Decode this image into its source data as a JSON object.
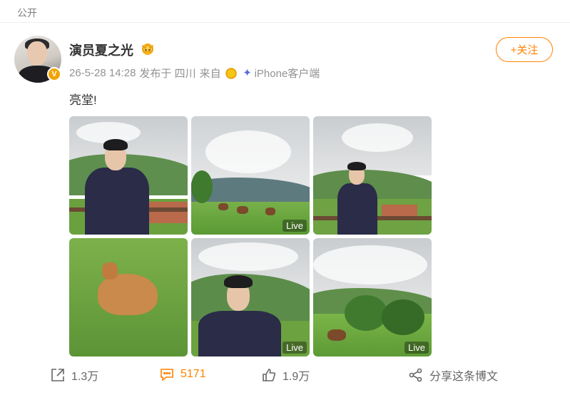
{
  "header": {
    "visibility": "公开"
  },
  "post": {
    "username": "演员夏之光",
    "crown_icon": "crown-icon",
    "verified_icon": "verified-v-icon",
    "follow_label": "+关注",
    "datetime": "26-5-28 14:28",
    "published_in": "发布于 四川",
    "source_prefix": "来自",
    "source": "iPhone客户端",
    "text": "亮堂!",
    "photos": [
      {
        "live": ""
      },
      {
        "live": "Live"
      },
      {
        "live": ""
      },
      {
        "live": ""
      },
      {
        "live": "Live"
      },
      {
        "live": "Live"
      }
    ]
  },
  "actions": {
    "share_count": "1.3万",
    "comment_count": "5171",
    "like_count": "1.9万",
    "share_to_label": "分享这条博文"
  },
  "colors": {
    "accent": "#ff8200",
    "verified": "#f2a300"
  }
}
